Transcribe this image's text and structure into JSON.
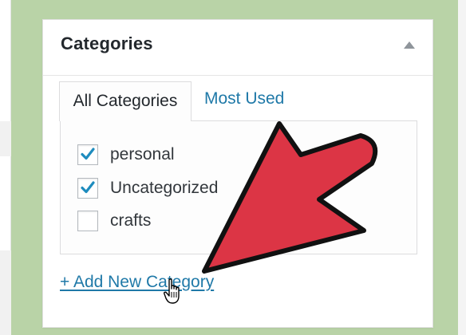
{
  "panel": {
    "title": "Categories",
    "toggle_icon": "triangle-up-icon"
  },
  "tabs": [
    {
      "label": "All Categories",
      "active": true
    },
    {
      "label": "Most Used",
      "active": false
    }
  ],
  "categories": [
    {
      "label": "personal",
      "checked": true
    },
    {
      "label": "Uncategorized",
      "checked": true
    },
    {
      "label": "crafts",
      "checked": false
    }
  ],
  "add_new_link": "+ Add New Category",
  "colors": {
    "background": "#b9d3a7",
    "link": "#1f79a8",
    "checkmark": "#1e8cbe",
    "arrow": "#dc3545",
    "arrow_outline": "#111111"
  },
  "overlay": {
    "arrow_icon": "big-pointing-arrow-icon",
    "cursor_icon": "hand-pointer-icon"
  }
}
